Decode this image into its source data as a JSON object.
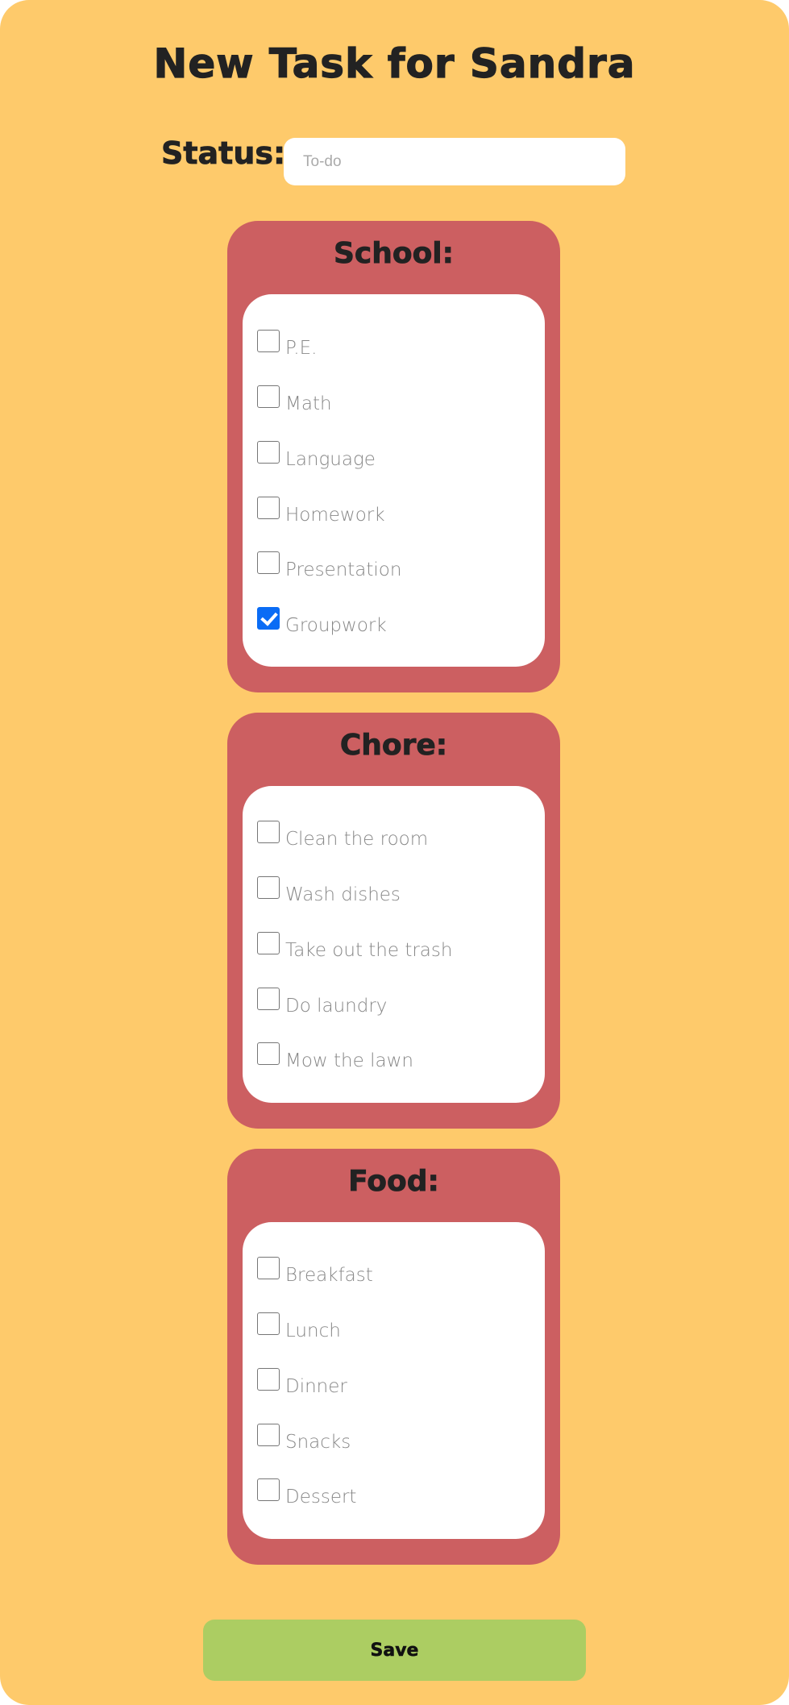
{
  "page": {
    "title": "New Task for Sandra"
  },
  "status": {
    "label": "Status:",
    "placeholder": "To-do",
    "value": ""
  },
  "categories": [
    {
      "title": "School:",
      "items": [
        {
          "label": "P.E.",
          "checked": false
        },
        {
          "label": "Math",
          "checked": false
        },
        {
          "label": "Language",
          "checked": false
        },
        {
          "label": "Homework",
          "checked": false
        },
        {
          "label": "Presentation",
          "checked": false
        },
        {
          "label": "Groupwork",
          "checked": true
        }
      ]
    },
    {
      "title": "Chore:",
      "items": [
        {
          "label": "Clean the room",
          "checked": false
        },
        {
          "label": "Wash dishes",
          "checked": false
        },
        {
          "label": "Take out the trash",
          "checked": false
        },
        {
          "label": "Do laundry",
          "checked": false
        },
        {
          "label": "Mow the lawn",
          "checked": false
        }
      ]
    },
    {
      "title": "Food:",
      "items": [
        {
          "label": "Breakfast",
          "checked": false
        },
        {
          "label": "Lunch",
          "checked": false
        },
        {
          "label": "Dinner",
          "checked": false
        },
        {
          "label": "Snacks",
          "checked": false
        },
        {
          "label": "Dessert",
          "checked": false
        }
      ]
    }
  ],
  "actions": {
    "save_label": "Save"
  },
  "colors": {
    "background": "#FECA6B",
    "card": "#CC5F61",
    "save_button": "#ACCD62",
    "checkbox_checked": "#0A6CF5"
  }
}
